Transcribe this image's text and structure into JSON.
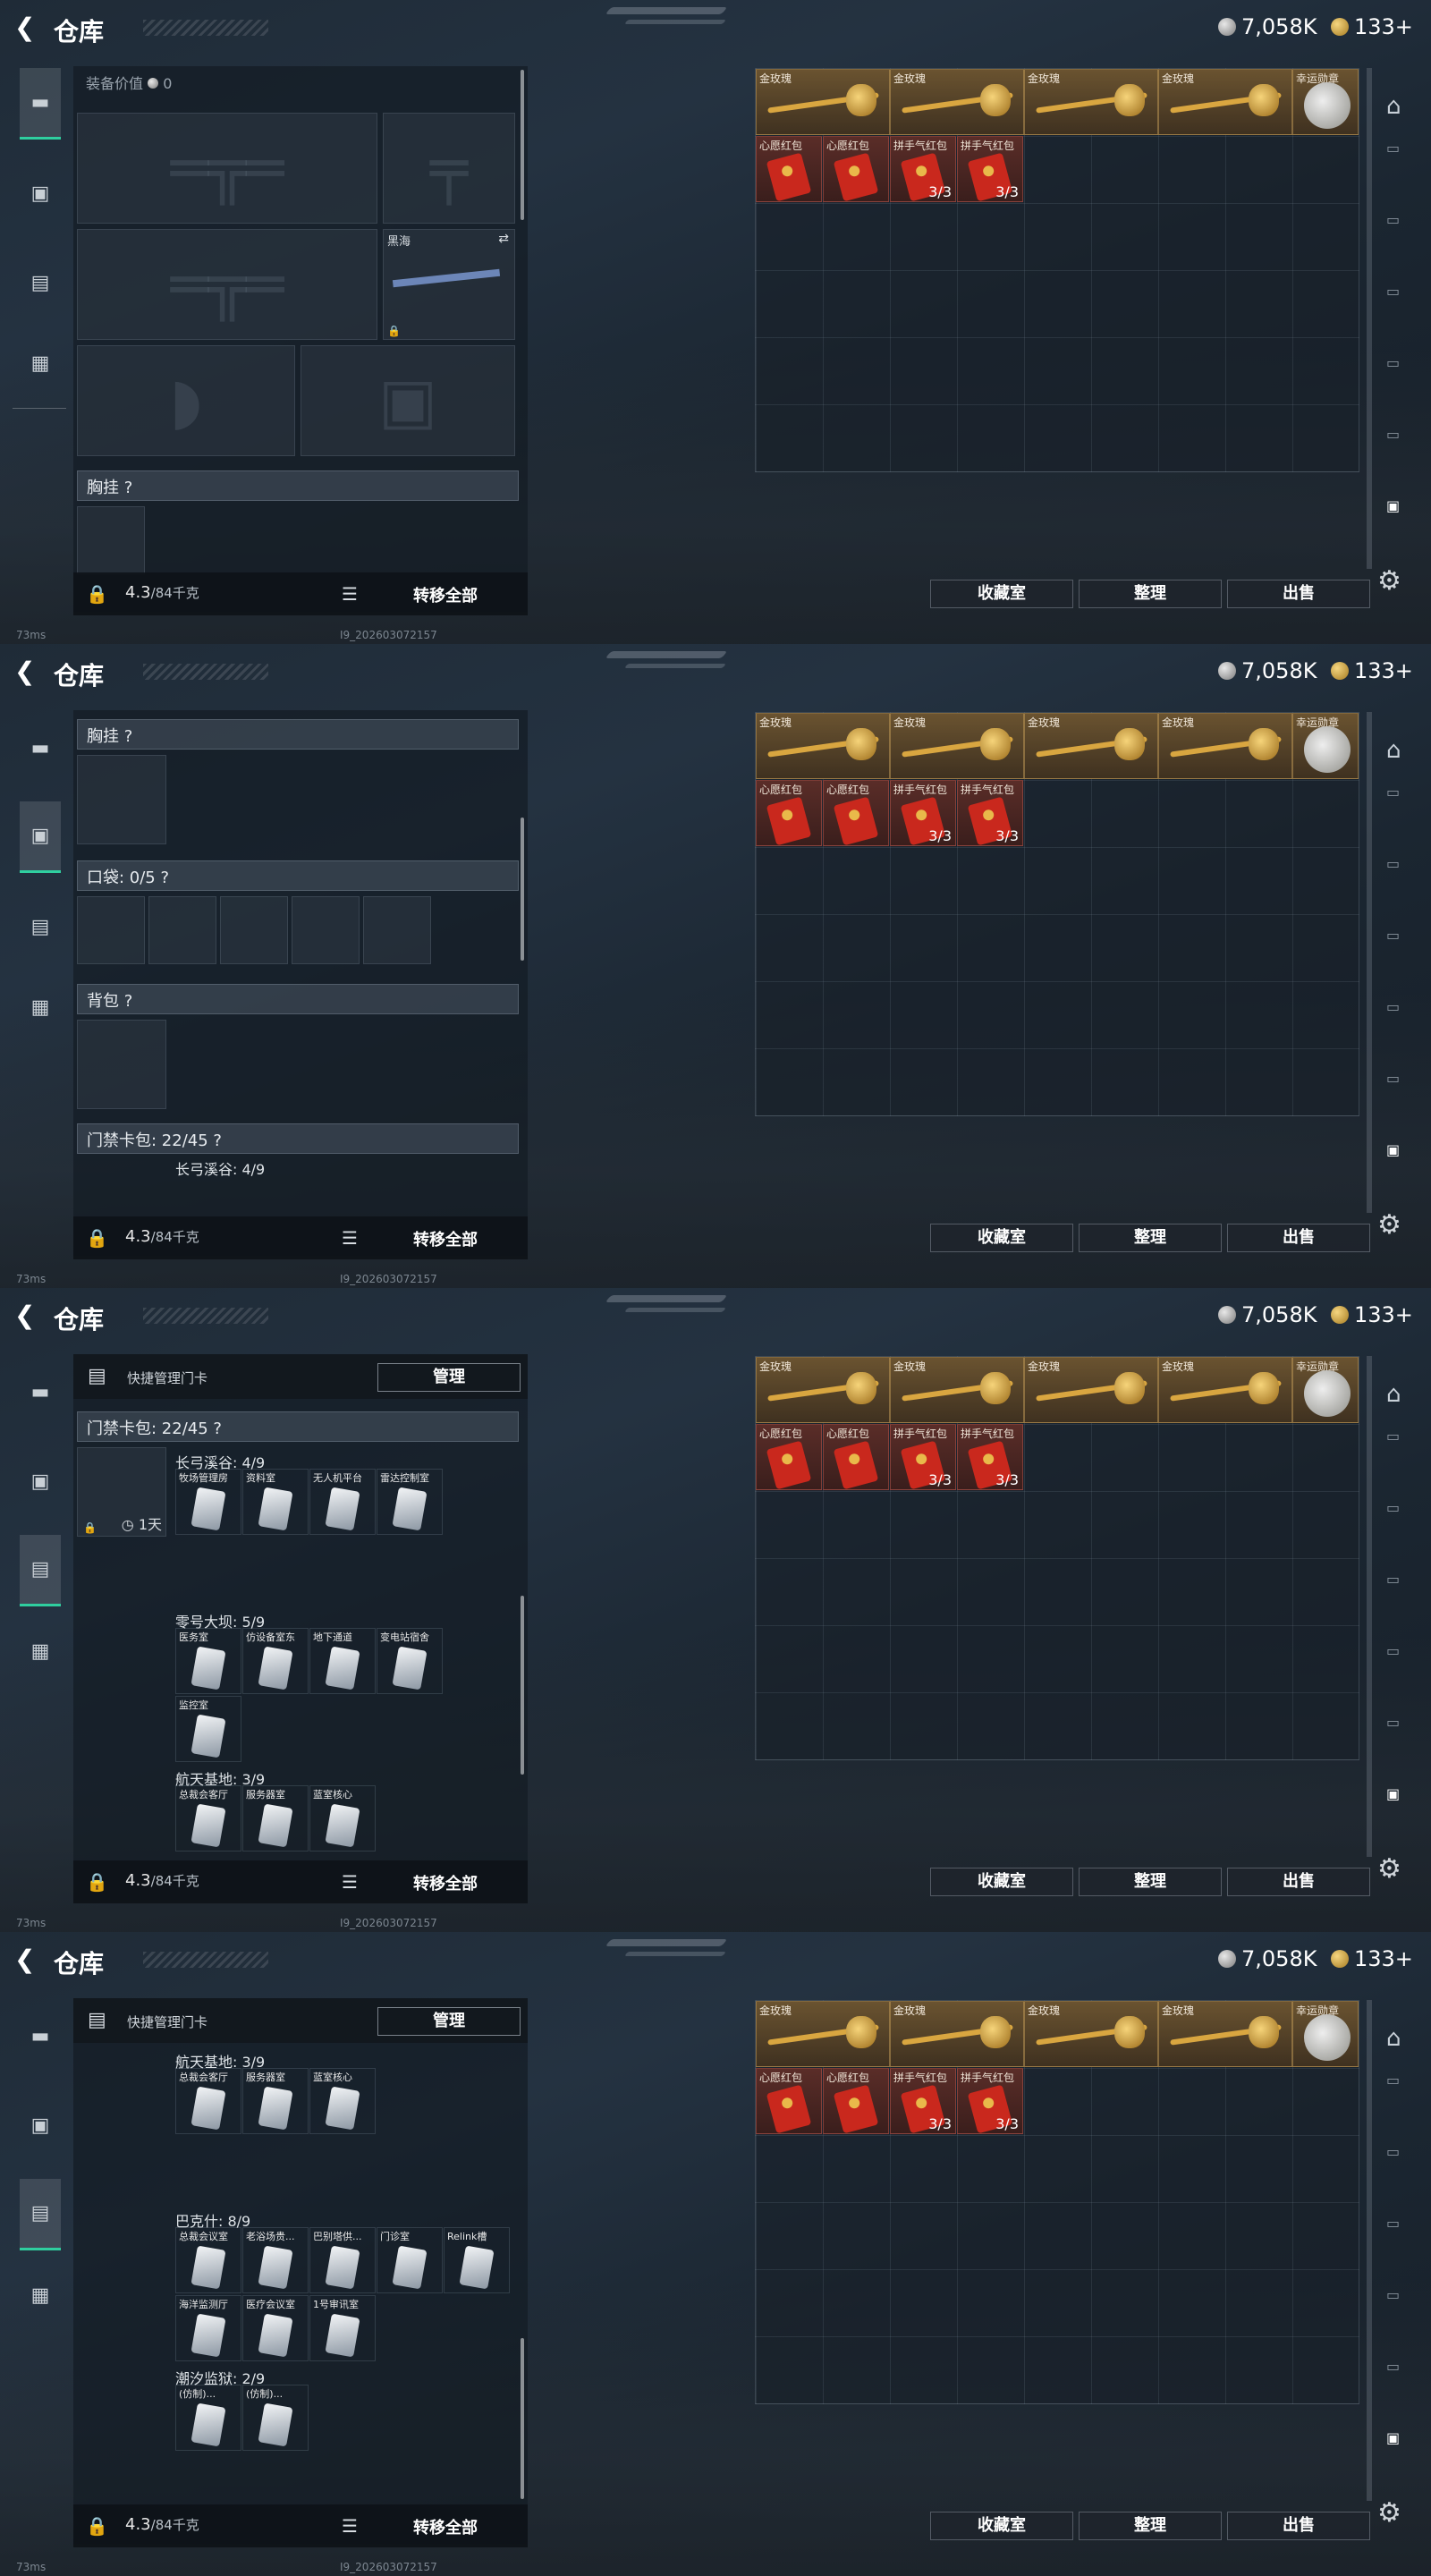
{
  "title": "仓库",
  "currency": {
    "silver": "7,058K",
    "gold": "133+"
  },
  "status": {
    "ping": "73ms",
    "build": "I9_202603072157"
  },
  "equip": {
    "value_label": "装备价值",
    "value": "0",
    "weapon_name": "黑海"
  },
  "sections": {
    "chest": "胸挂 ?",
    "pocket": "口袋: 0/5 ?",
    "backpack": "背包 ?",
    "keycard": "门禁卡包: 22/45 ?"
  },
  "keycard": {
    "manage_label": "快捷管理门卡",
    "manage_btn": "管理",
    "timer": "1天",
    "groups": [
      {
        "name": "长弓溪谷: 4/9",
        "cards": [
          "牧场管理房",
          "资料室",
          "无人机平台",
          "雷达控制室"
        ]
      },
      {
        "name": "零号大坝: 5/9",
        "cards": [
          "医务室",
          "仿设备室东",
          "地下通道",
          "变电站宿舍",
          "监控室"
        ]
      },
      {
        "name": "航天基地: 3/9",
        "cards": [
          "总裁会客厅",
          "服务器室",
          "蓝室核心"
        ]
      },
      {
        "name": "巴克什: 8/9",
        "cards": [
          "总裁会议室",
          "老浴场贵...",
          "巴别塔供...",
          "门诊室",
          "Relink槽",
          "海洋监测厅",
          "医疗会议室",
          "1号审讯室"
        ]
      },
      {
        "name": "潮汐监狱: 2/9",
        "cards": [
          "(仿制)...",
          "(仿制)..."
        ]
      }
    ]
  },
  "bottom": {
    "weight": "4.3",
    "weight_max": "/84千克",
    "transfer": "转移全部"
  },
  "stash": {
    "items": [
      {
        "name": "金玫瑰",
        "type": "rose"
      },
      {
        "name": "金玫瑰",
        "type": "rose"
      },
      {
        "name": "金玫瑰",
        "type": "rose"
      },
      {
        "name": "金玫瑰",
        "type": "rose"
      },
      {
        "name": "幸运勋章",
        "type": "moon"
      },
      {
        "name": "心愿红包",
        "type": "env"
      },
      {
        "name": "心愿红包",
        "type": "env"
      },
      {
        "name": "拼手气红包",
        "type": "env",
        "count": "3/3"
      },
      {
        "name": "拼手气红包",
        "type": "env",
        "count": "3/3"
      }
    ],
    "buttons": {
      "collection": "收藏室",
      "sort": "整理",
      "sell": "出售"
    }
  },
  "colors": {
    "accent": "#2fcf9f",
    "gold_item": "#6a5330",
    "red_item": "#5a2d28"
  },
  "icons": {
    "weapon": "gun-icon",
    "armor": "vest-icon",
    "keycard": "keycard-icon",
    "case": "briefcase-icon"
  }
}
